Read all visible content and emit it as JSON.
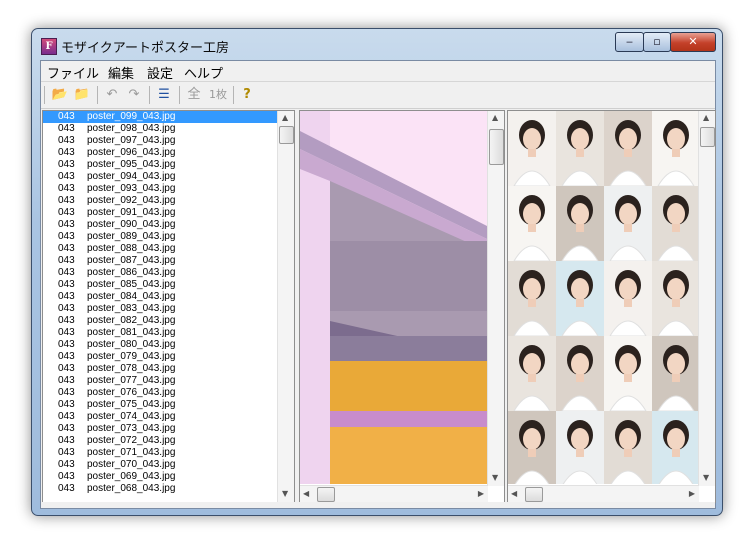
{
  "window": {
    "title": "モザイクアートポスター工房",
    "icon_letter": "F",
    "controls": {
      "minimize": "‒",
      "maximize": "▫",
      "close": "✕"
    }
  },
  "menu": [
    "ファイル",
    "編集",
    "設定",
    "ヘルプ"
  ],
  "toolbar": {
    "open": "📂",
    "save": "📁",
    "undo": "↶",
    "redo": "↷",
    "list": "☰",
    "all": "全",
    "single": "1枚",
    "help": "?"
  },
  "file_list": [
    {
      "num": "043",
      "name": "poster_099_043.jpg",
      "selected": true
    },
    {
      "num": "043",
      "name": "poster_098_043.jpg"
    },
    {
      "num": "043",
      "name": "poster_097_043.jpg"
    },
    {
      "num": "043",
      "name": "poster_096_043.jpg"
    },
    {
      "num": "043",
      "name": "poster_095_043.jpg"
    },
    {
      "num": "043",
      "name": "poster_094_043.jpg"
    },
    {
      "num": "043",
      "name": "poster_093_043.jpg"
    },
    {
      "num": "043",
      "name": "poster_092_043.jpg"
    },
    {
      "num": "043",
      "name": "poster_091_043.jpg"
    },
    {
      "num": "043",
      "name": "poster_090_043.jpg"
    },
    {
      "num": "043",
      "name": "poster_089_043.jpg"
    },
    {
      "num": "043",
      "name": "poster_088_043.jpg"
    },
    {
      "num": "043",
      "name": "poster_087_043.jpg"
    },
    {
      "num": "043",
      "name": "poster_086_043.jpg"
    },
    {
      "num": "043",
      "name": "poster_085_043.jpg"
    },
    {
      "num": "043",
      "name": "poster_084_043.jpg"
    },
    {
      "num": "043",
      "name": "poster_083_043.jpg"
    },
    {
      "num": "043",
      "name": "poster_082_043.jpg"
    },
    {
      "num": "043",
      "name": "poster_081_043.jpg"
    },
    {
      "num": "043",
      "name": "poster_080_043.jpg"
    },
    {
      "num": "043",
      "name": "poster_079_043.jpg"
    },
    {
      "num": "043",
      "name": "poster_078_043.jpg"
    },
    {
      "num": "043",
      "name": "poster_077_043.jpg"
    },
    {
      "num": "043",
      "name": "poster_076_043.jpg"
    },
    {
      "num": "043",
      "name": "poster_075_043.jpg"
    },
    {
      "num": "043",
      "name": "poster_074_043.jpg"
    },
    {
      "num": "043",
      "name": "poster_073_043.jpg"
    },
    {
      "num": "043",
      "name": "poster_072_043.jpg"
    },
    {
      "num": "043",
      "name": "poster_071_043.jpg"
    },
    {
      "num": "043",
      "name": "poster_070_043.jpg"
    },
    {
      "num": "043",
      "name": "poster_069_043.jpg"
    },
    {
      "num": "043",
      "name": "poster_068_043.jpg"
    }
  ],
  "scroll": {
    "up": "▲",
    "down": "▼",
    "left": "◀",
    "right": "▶"
  },
  "colors": {
    "selection": "#3399ff",
    "preview_pink": "#fbe3f6",
    "preview_purple": "#8a7d9c",
    "preview_orange": "#e7a82e"
  }
}
